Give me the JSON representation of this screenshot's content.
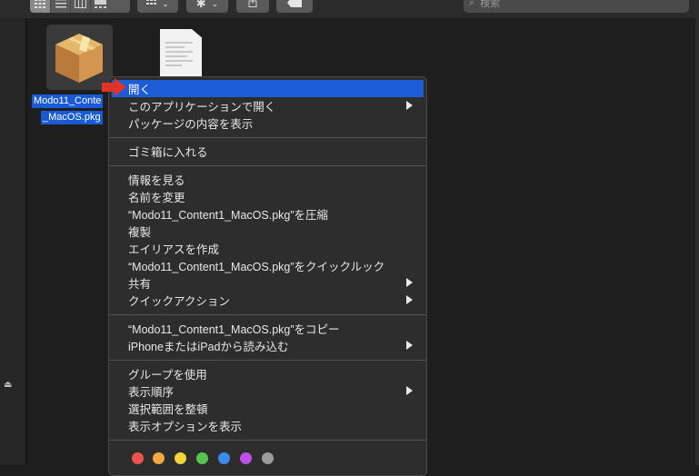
{
  "toolbar": {
    "view_icons": [
      "icon-view-icon",
      "list-view-icon",
      "column-view-icon",
      "gallery-view-icon"
    ],
    "search_placeholder": "検索"
  },
  "files": [
    {
      "name_line1": "Modo11_Conte",
      "name_line2": "_MacOS.pkg",
      "icon": "package-icon",
      "selected": true
    },
    {
      "icon": "document-icon",
      "selected": false
    }
  ],
  "context_menu": {
    "highlight_color": "#1c5cd4",
    "items": [
      {
        "label": "開く",
        "highlighted": true
      },
      {
        "label": "このアプリケーションで開く",
        "submenu": true
      },
      {
        "label": "パッケージの内容を表示"
      },
      {
        "label": "ゴミ箱に入れる"
      },
      {
        "label": "情報を見る"
      },
      {
        "label": "名前を変更"
      },
      {
        "label": "“Modo11_Content1_MacOS.pkg”を圧縮"
      },
      {
        "label": "複製"
      },
      {
        "label": "エイリアスを作成"
      },
      {
        "label": "“Modo11_Content1_MacOS.pkg”をクイックルック"
      },
      {
        "label": "共有",
        "submenu": true
      },
      {
        "label": "クイックアクション",
        "submenu": true
      },
      {
        "label": "“Modo11_Content1_MacOS.pkg”をコピー"
      },
      {
        "label": "iPhoneまたはiPadから読み込む",
        "submenu": true
      },
      {
        "label": "グループを使用"
      },
      {
        "label": "表示順序",
        "submenu": true
      },
      {
        "label": "選択範囲を整頓"
      },
      {
        "label": "表示オプションを表示"
      }
    ],
    "tag_colors": [
      "#ef5350",
      "#f4a742",
      "#f5d33f",
      "#58c450",
      "#3c8cf0",
      "#c04ee8",
      "#9b9b9b"
    ]
  }
}
